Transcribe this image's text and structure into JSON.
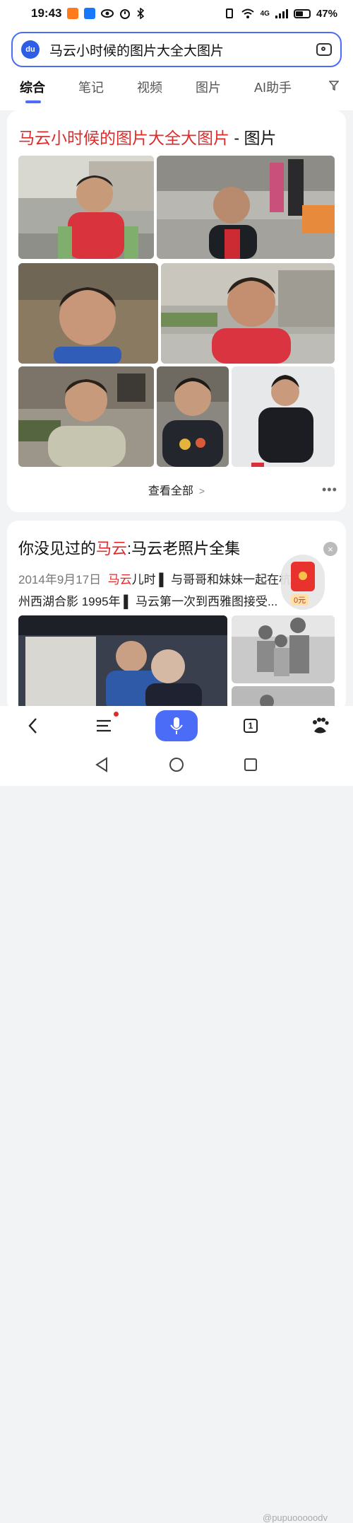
{
  "status_bar": {
    "time": "19:43",
    "network": "4G",
    "battery": "47%"
  },
  "search": {
    "query": "马云小时候的图片大全大图片",
    "logo_text": "du"
  },
  "tabs": [
    {
      "label": "综合",
      "active": true
    },
    {
      "label": "笔记",
      "active": false
    },
    {
      "label": "视频",
      "active": false
    },
    {
      "label": "图片",
      "active": false
    },
    {
      "label": "AI助手",
      "active": false
    }
  ],
  "image_card": {
    "title_highlight": "马云小时候的图片大全大图片",
    "title_suffix": " - 图片",
    "see_all": "查看全部",
    "more": "•••"
  },
  "article_card": {
    "title_pre": "你没见过的",
    "title_highlight": "马云",
    "title_post": ":马云老照片全集",
    "date": "2014年9月17日",
    "snippet_highlight": "马云",
    "snippet_line1": "儿时 ▌ 与哥哥和妹妹一起在杭",
    "snippet_line2": "州西湖合影 1995年 ▌ 马云第一次到西雅图接受...",
    "close": "×"
  },
  "red_packet": {
    "amount": "0元"
  },
  "toolbar": {
    "tab_count": "1"
  },
  "watermark": "@pupuooooodv",
  "colors": {
    "accent": "#4a6cf7",
    "highlight_red": "#e02b2b"
  }
}
